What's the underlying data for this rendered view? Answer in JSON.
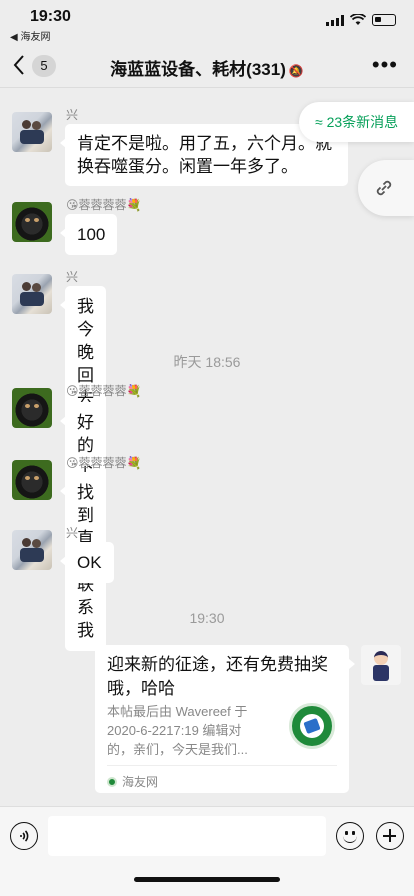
{
  "status": {
    "time": "19:30",
    "back_app": "◀ 海友网"
  },
  "nav": {
    "back_icon": "chevron-left-icon",
    "unread": "5",
    "title": "海蓝蓝设备、耗材(331)",
    "mute_icon": "bell-off-icon",
    "more_icon": "more-icon"
  },
  "float": {
    "new_messages": "≈ 23条新消息",
    "link_icon": "link-icon"
  },
  "messages": [
    {
      "sender": "兴",
      "text_line1": "肯定不是啦。用了五，六个月。就",
      "text_line2": "换吞噬蛋分。闲置一年多了。"
    },
    {
      "sender": "😘蓉蓉蓉蓉💐",
      "text": "100"
    },
    {
      "sender": "兴",
      "text": "我今晚回去找一下先"
    },
    {
      "sender": "😘蓉蓉蓉蓉💐",
      "text": "好的"
    },
    {
      "sender": "😘蓉蓉蓉蓉💐",
      "text": "找到直接联系我"
    },
    {
      "sender": "兴",
      "text": "OK"
    }
  ],
  "timestamps": {
    "t1": "昨天 18:56",
    "t2": "19:30"
  },
  "card": {
    "title_line1": "迎来新的征途，还有免费抽奖",
    "title_line2": "哦，哈哈",
    "desc_line1": "本帖最后由 Wavereef 于",
    "desc_line2": "2020-6-2217:19 编辑对",
    "desc_line3": "的，亲们，今天是我们...",
    "source": "海友网"
  },
  "inputbar": {
    "voice_icon": "voice-icon",
    "emoji_icon": "emoji-icon",
    "plus_icon": "plus-icon"
  },
  "colors": {
    "accent_green": "#07a05a",
    "background": "#ededed"
  }
}
